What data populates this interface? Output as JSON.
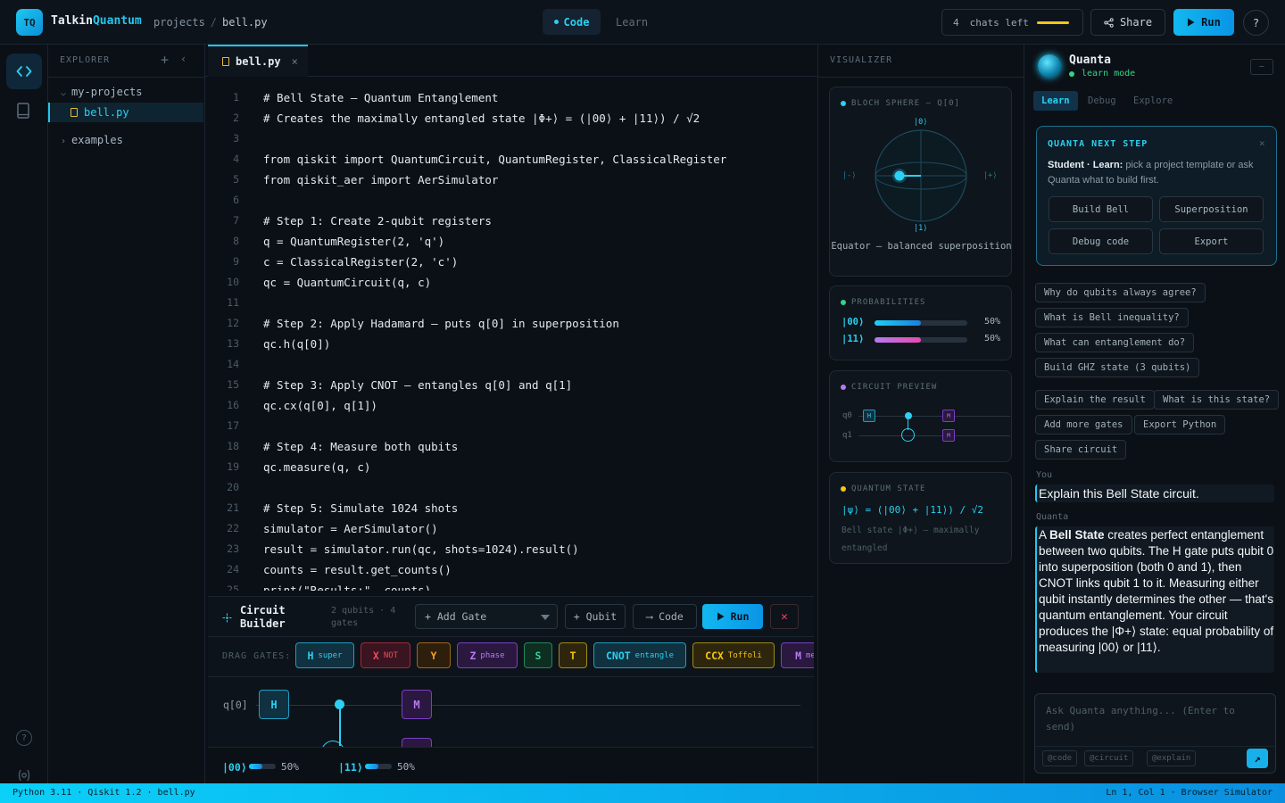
{
  "app": {
    "logo": "TQ",
    "brand_a": "Talkin",
    "brand_b": "Quantum",
    "breadcrumb_root": "projects",
    "breadcrumb_sep": "/",
    "breadcrumb_file": "bell.py",
    "mode_code": "Code",
    "mode_learn": "Learn",
    "chats_count": "4",
    "chats_label": "chats left",
    "share": "Share",
    "run": "Run",
    "help": "?"
  },
  "explorer": {
    "title": "EXPLORER",
    "folder": "my-projects",
    "file": "bell.py",
    "examples": "examples"
  },
  "editor": {
    "tab": "bell.py",
    "lines": [
      "# Bell State — Quantum Entanglement",
      "# Creates the maximally entangled state |Φ+⟩ = (|00⟩ + |11⟩) / √2",
      "",
      "from qiskit import QuantumCircuit, QuantumRegister, ClassicalRegister",
      "from qiskit_aer import AerSimulator",
      "",
      "# Step 1: Create 2-qubit registers",
      "q = QuantumRegister(2, 'q')",
      "c = ClassicalRegister(2, 'c')",
      "qc = QuantumCircuit(q, c)",
      "",
      "# Step 2: Apply Hadamard — puts q[0] in superposition",
      "qc.h(q[0])",
      "",
      "# Step 3: Apply CNOT — entangles q[0] and q[1]",
      "qc.cx(q[0], q[1])",
      "",
      "# Step 4: Measure both qubits",
      "qc.measure(q, c)",
      "",
      "# Step 5: Simulate 1024 shots",
      "simulator = AerSimulator()",
      "result = simulator.run(qc, shots=1024).result()",
      "counts = result.get_counts()",
      "print(\"Results:\", counts)"
    ]
  },
  "builder": {
    "title": "Circuit Builder",
    "meta": "2 qubits · 4 gates",
    "add_gate": "+ Add Gate",
    "qubit": "+ Qubit",
    "code": "⟶ Code",
    "run": "Run",
    "close": "✕",
    "drag_label": "DRAG GATES:",
    "gates": [
      {
        "name": "H",
        "sub": "super",
        "color": "#2bd0f2",
        "bg": "#0f3140",
        "border": "#1f9ec0"
      },
      {
        "name": "X",
        "sub": "NOT",
        "color": "#f04a5a",
        "bg": "#3a1420",
        "border": "#a02a3a"
      },
      {
        "name": "Y",
        "sub": "",
        "color": "#f5a524",
        "bg": "#2e1f0c",
        "border": "#a0661a"
      },
      {
        "name": "Z",
        "sub": "phase",
        "color": "#b57bf0",
        "bg": "#2a1840",
        "border": "#7a3fc0"
      },
      {
        "name": "S",
        "sub": "",
        "color": "#34d38a",
        "bg": "#0e2e22",
        "border": "#1f8a5a"
      },
      {
        "name": "T",
        "sub": "",
        "color": "#f5c518",
        "bg": "#2e260c",
        "border": "#a08a1a"
      },
      {
        "name": "CNOT",
        "sub": "entangle",
        "color": "#2bd0f2",
        "bg": "#0f3140",
        "border": "#1f9ec0"
      },
      {
        "name": "CCX",
        "sub": "Toffoli",
        "color": "#f5c518",
        "bg": "#2e260c",
        "border": "#a08a1a"
      },
      {
        "name": "M",
        "sub": "measure",
        "color": "#b57bf0",
        "bg": "#2a1840",
        "border": "#7a3fc0"
      }
    ],
    "wire_label": "q[0]",
    "gate_h": "H",
    "gate_m": "M",
    "results": [
      {
        "state": "|00⟩",
        "value": "50%",
        "fraction": 0.5
      },
      {
        "state": "|11⟩",
        "value": "50%",
        "fraction": 0.5
      }
    ]
  },
  "visualizer": {
    "title": "VISUALIZER",
    "bloch_title": "BLOCH SPHERE — Q[0]",
    "bloch_top": "|0⟩",
    "bloch_bottom": "|1⟩",
    "bloch_left": "|-⟩",
    "bloch_right": "|+⟩",
    "bloch_caption": "Equator — balanced superposition",
    "prob_title": "PROBABILITIES",
    "probs": [
      {
        "state": "|00⟩",
        "value": "50%",
        "fraction": 0.5
      },
      {
        "state": "|11⟩",
        "value": "50%",
        "fraction": 0.5
      }
    ],
    "circuit_title": "CIRCUIT PREVIEW",
    "q0": "q0",
    "q1": "q1",
    "mini_h": "H",
    "mini_m": "M",
    "state_title": "QUANTUM STATE",
    "state_formula": "|ψ⟩ = (|00⟩ + |11⟩) / √2",
    "state_desc": "Bell state |Φ+⟩ — maximally entangled",
    "colors": {
      "accent": "#2bd0f2",
      "purple": "#b57bf0",
      "green": "#34d38a",
      "yellow": "#f5c518"
    }
  },
  "chat": {
    "name": "Quanta",
    "status": "learn mode",
    "minimize": "—",
    "tabs": [
      "Learn",
      "Debug",
      "Explore"
    ],
    "next_title": "QUANTA NEXT STEP",
    "next_close": "×",
    "next_bold": "Student · Learn:",
    "next_text": " pick a project template or ask Quanta what to build first.",
    "next_buttons": [
      "Build Bell",
      "Superposition",
      "Debug code",
      "Export"
    ],
    "chips": [
      "Why do qubits always agree?",
      "What is Bell inequality?",
      "What can entanglement do?",
      "Build GHZ state (3 qubits)",
      "Explain the result",
      "What is this state?",
      "Add more gates",
      "Export Python",
      "Share circuit"
    ],
    "you_label": "You",
    "user_message": "Explain this Bell State circuit.",
    "bot_label": "Quanta",
    "bot_bold": "Bell State",
    "bot_prefix": "A ",
    "bot_message": " creates perfect entanglement between two qubits. The H gate puts qubit 0 into superposition (both 0 and 1), then CNOT links qubit 1 to it. Measuring either qubit instantly determines the other — that's quantum entanglement. Your circuit produces the |Φ+⟩ state: equal probability of measuring |00⟩ or |11⟩.",
    "input_placeholder": "Ask Quanta anything... (Enter to send)",
    "input_tags": [
      "@code",
      "@circuit",
      "@explain"
    ],
    "send": "↗"
  },
  "statusbar": {
    "left": "Python 3.11 · Qiskit 1.2 · bell.py",
    "right": "Ln 1, Col 1 · Browser Simulator"
  }
}
